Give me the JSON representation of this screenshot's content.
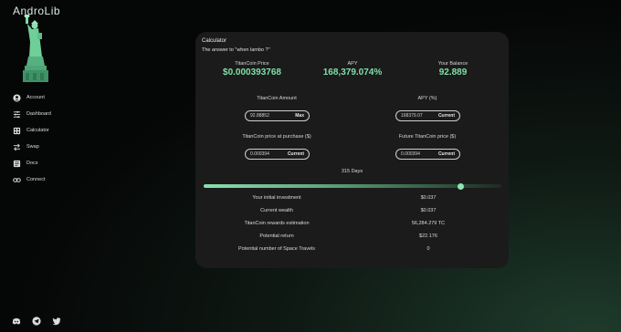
{
  "app": {
    "logo": "AndroLib"
  },
  "colors": {
    "accent": "#7fe0a8",
    "card_bg": "#1b1b1b"
  },
  "sidebar": {
    "items": [
      {
        "label": "Account",
        "icon": "account-icon"
      },
      {
        "label": "Dashboard",
        "icon": "dashboard-sliders-icon"
      },
      {
        "label": "Calculator",
        "icon": "calculator-icon"
      },
      {
        "label": "Swap",
        "icon": "swap-arrows-icon"
      },
      {
        "label": "Docs",
        "icon": "docs-icon"
      },
      {
        "label": "Connect",
        "icon": "link-icon"
      }
    ]
  },
  "footer": {
    "icons": [
      "discord-icon",
      "telegram-icon",
      "twitter-icon"
    ]
  },
  "calculator": {
    "title": "Calculator",
    "subtitle": "The answer to \"when lambo ?\"",
    "stats": {
      "price_label": "TitanCoin Price",
      "price_value": "$0.000393768",
      "apy_label": "APY",
      "apy_value": "168,379.074%",
      "balance_label": "Your Balance",
      "balance_value": "92.889"
    },
    "fields": {
      "amount_label": "TitanCoin Amount",
      "amount_value": "92.88852",
      "amount_btn": "Max",
      "apy_label": "APY (%)",
      "apy_value": "168379.07",
      "apy_btn": "Current",
      "purchase_label": "TitanCoin price at purchase ($)",
      "purchase_value": "0.000394",
      "purchase_btn": "Current",
      "future_label": "Future TitanCoin price ($)",
      "future_value": "0.000394",
      "future_btn": "Current"
    },
    "days_label": "315 Days",
    "slider_fraction": 0.865,
    "results": [
      {
        "label": "Your initial investment",
        "value": "$0.037"
      },
      {
        "label": "Current wealth",
        "value": "$0.037"
      },
      {
        "label": "TitanCoin rewards estimation",
        "value": "56,284.279 TC"
      },
      {
        "label": "Potential return",
        "value": "$22.176"
      },
      {
        "label": "Potential number of Space Travels",
        "value": "0"
      }
    ]
  }
}
